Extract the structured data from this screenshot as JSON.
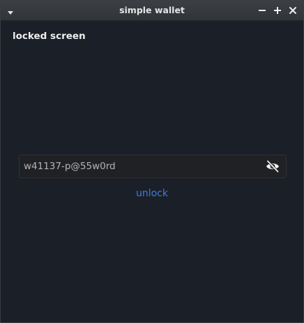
{
  "window": {
    "title": "simple wallet"
  },
  "screen": {
    "heading": "locked screen"
  },
  "password": {
    "value": "w41137-p@55w0rd",
    "placeholder": "",
    "toggle_icon": "eye-slash-icon"
  },
  "actions": {
    "unlock_label": "unlock"
  },
  "colors": {
    "background": "#1b1f27",
    "titlebar": "#36393e",
    "field_bg": "#202125",
    "link": "#3e7be0",
    "text": "#eeeeee"
  }
}
